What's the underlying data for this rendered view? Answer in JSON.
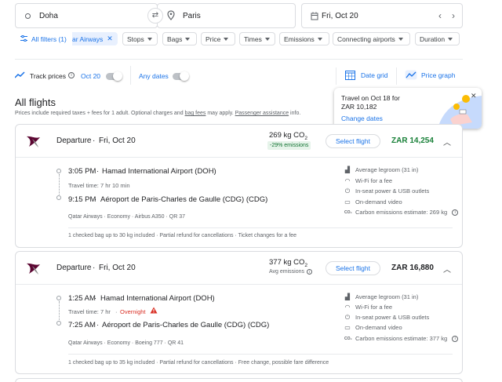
{
  "search": {
    "origin": "Doha",
    "destination": "Paris",
    "date": "Fri, Oct 20"
  },
  "filters": {
    "all_filters": "All filters (1)",
    "airline_chip": "ar Airways",
    "chips": [
      "Stops",
      "Bags",
      "Price",
      "Times",
      "Emissions",
      "Connecting airports",
      "Duration"
    ]
  },
  "tracking": {
    "track_label": "Track prices",
    "track_date": "Oct 20",
    "any_dates": "Any dates",
    "date_grid": "Date grid",
    "price_graph": "Price graph"
  },
  "tooltip": {
    "line1": "Travel on Oct 18 for",
    "line2": "ZAR 10,182",
    "link": "Change dates"
  },
  "results": {
    "title": "All flights",
    "note_prefix": "Prices include required taxes + fees for 1 adult. Optional charges and ",
    "note_link1": "bag fees",
    "note_mid": " may apply. ",
    "note_link2": "Passenger assistance",
    "note_suffix": " info."
  },
  "flights": [
    {
      "label": "Departure",
      "sep": "·",
      "date": "Fri, Oct 20",
      "emissions": "269 kg CO",
      "emissions_sub": "2",
      "emissions_badge": "-29% emissions",
      "select": "Select flight",
      "price": "ZAR 14,254",
      "dep_time": "3:05 PM",
      "dep_airport": "Hamad International Airport (DOH)",
      "travel_time": "Travel time: 7 hr 10 min",
      "arr_time": "9:15 PM",
      "arr_airport": "Aéroport de Paris-Charles de Gaulle (CDG) (CDG)",
      "details": "Qatar Airways · Economy · Airbus A350 · QR 37",
      "footer": "1 checked bag up to 30 kg included · Partial refund for cancellations · Ticket changes for a fee",
      "amenities": [
        "Average legroom (31 in)",
        "Wi-Fi for a fee",
        "In-seat power & USB outlets",
        "On-demand video",
        "Carbon emissions estimate: 269 kg"
      ]
    },
    {
      "label": "Departure",
      "sep": "·",
      "date": "Fri, Oct 20",
      "emissions": "377 kg CO",
      "emissions_sub": "2",
      "emissions_badge": "Avg emissions",
      "select": "Select flight",
      "price": "ZAR 16,880",
      "dep_time": "1:25 AM",
      "dep_airport": "Hamad International Airport (DOH)",
      "travel_time": "Travel time: 7 hr",
      "overnight": "Overnight",
      "arr_time": "7:25 AM",
      "arr_airport": "Aéroport de Paris-Charles de Gaulle (CDG) (CDG)",
      "details": "Qatar Airways · Economy · Boeing 777 · QR 41",
      "footer": "1 checked bag up to 35 kg included · Partial refund for cancellations · Free change, possible fare difference",
      "amenities": [
        "Average legroom (31 in)",
        "Wi-Fi for a fee",
        "In-seat power & USB outlets",
        "On-demand video",
        "Carbon emissions estimate: 377 kg"
      ]
    }
  ],
  "colors": {
    "accent": "#1a73e8",
    "price_green": "#188038",
    "badge_bg": "#e6f4ea",
    "airline": "#5c0632",
    "warning": "#d93025"
  }
}
